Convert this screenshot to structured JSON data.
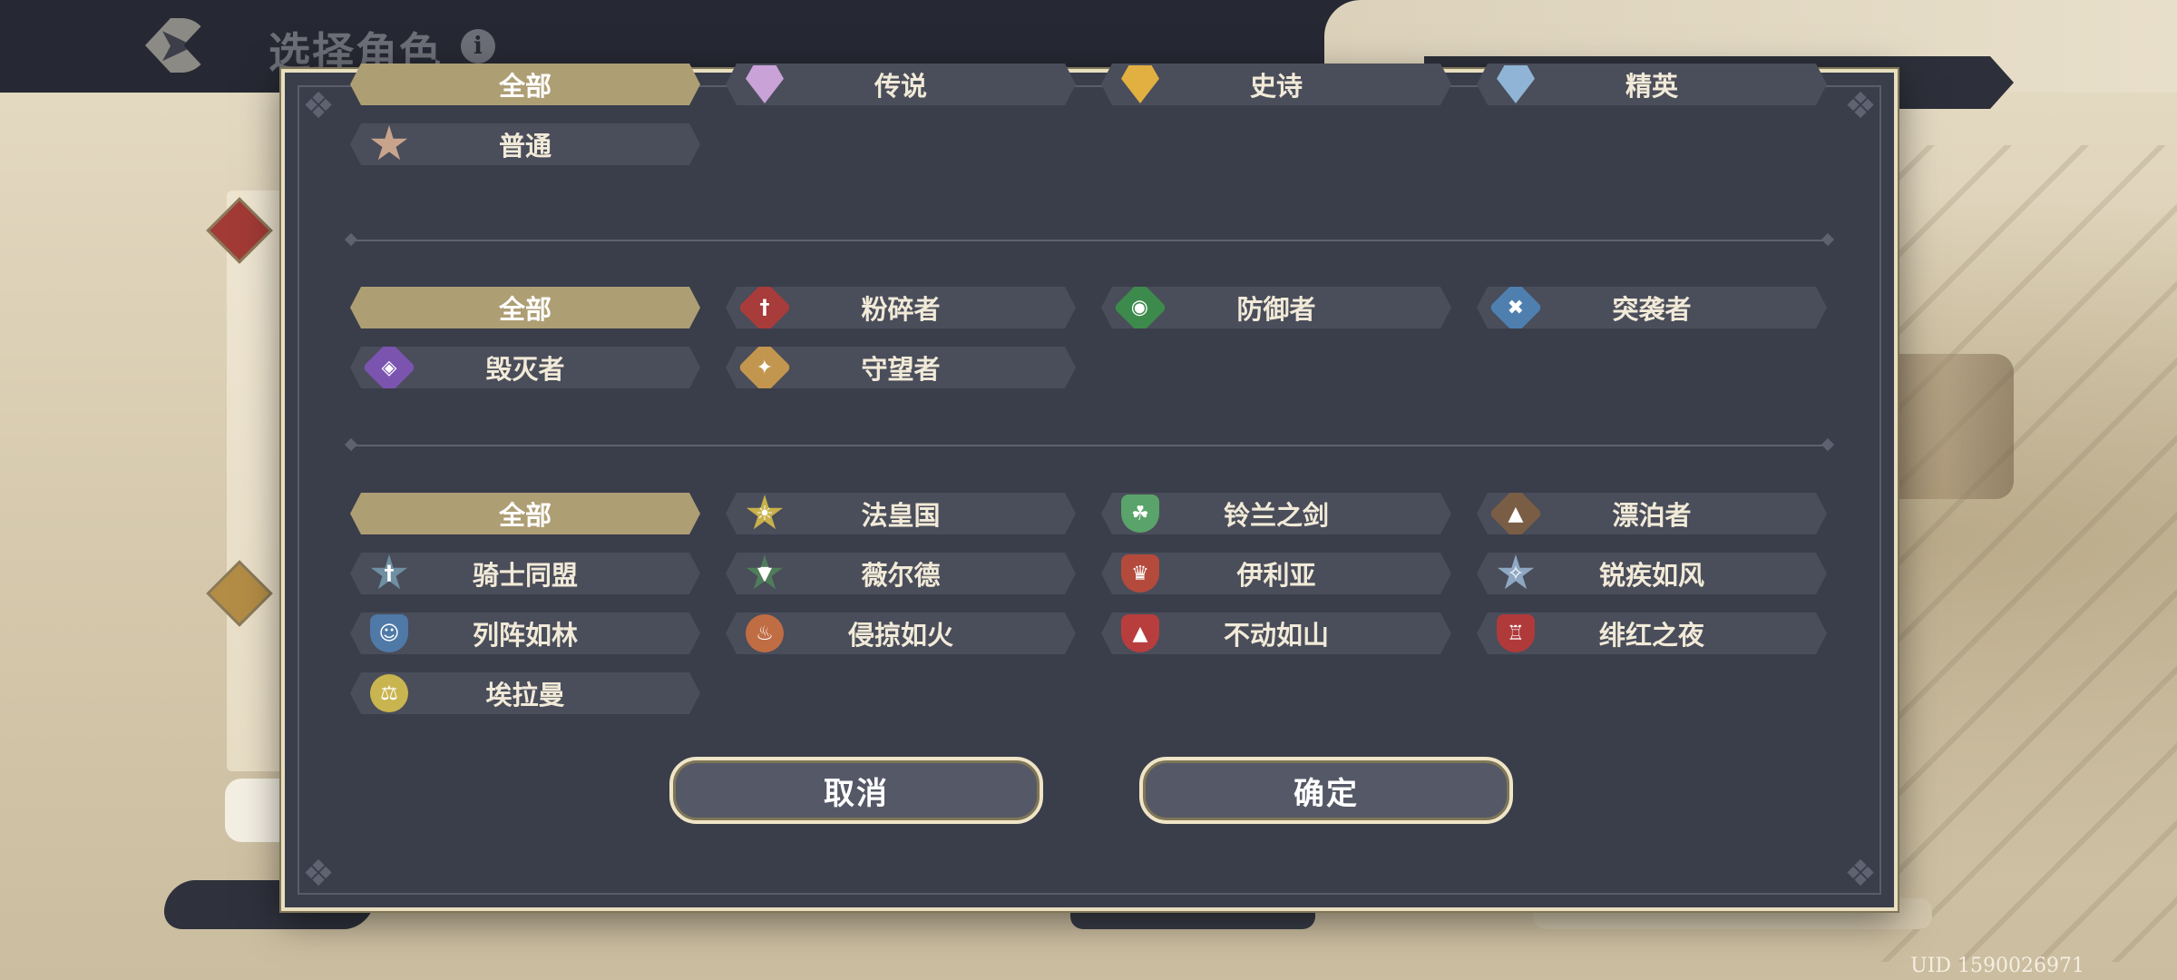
{
  "header": {
    "title": "选择角色",
    "back_icon": "back-arrow-icon",
    "info_icon": "info-icon"
  },
  "footer": {
    "uid": "UID 1590026971"
  },
  "filter_modal": {
    "rarity": [
      {
        "label": "全部",
        "selected": true,
        "icon": ""
      },
      {
        "label": "传说",
        "selected": false,
        "icon": "legendary-gem-icon",
        "color": "#c9a2d8"
      },
      {
        "label": "史诗",
        "selected": false,
        "icon": "epic-gem-icon",
        "color": "#e2b041"
      },
      {
        "label": "精英",
        "selected": false,
        "icon": "elite-gem-icon",
        "color": "#8fb4d6"
      },
      {
        "label": "普通",
        "selected": false,
        "icon": "common-gem-icon",
        "color": "#c9a48c"
      }
    ],
    "class": [
      {
        "label": "全部",
        "selected": true,
        "icon": ""
      },
      {
        "label": "粉碎者",
        "selected": false,
        "icon": "sword-class-icon",
        "color": "#a83c3a"
      },
      {
        "label": "防御者",
        "selected": false,
        "icon": "shield-class-icon",
        "color": "#3c8a4c"
      },
      {
        "label": "突袭者",
        "selected": false,
        "icon": "crossed-blades-class-icon",
        "color": "#4f7fae"
      },
      {
        "label": "毁灭者",
        "selected": false,
        "icon": "arcane-class-icon",
        "color": "#7b54b0"
      },
      {
        "label": "守望者",
        "selected": false,
        "icon": "compass-star-class-icon",
        "color": "#c2964e"
      }
    ],
    "faction": [
      {
        "label": "全部",
        "selected": true,
        "icon": ""
      },
      {
        "label": "法皇国",
        "selected": false,
        "icon": "sun-faction-icon",
        "color": "#c8b14a"
      },
      {
        "label": "铃兰之剑",
        "selected": false,
        "icon": "lily-shield-faction-icon",
        "color": "#5aa36a"
      },
      {
        "label": "漂泊者",
        "selected": false,
        "icon": "wanderer-faction-icon",
        "color": "#7a5d45"
      },
      {
        "label": "骑士同盟",
        "selected": false,
        "icon": "knight-wings-faction-icon",
        "color": "#6f8fa3"
      },
      {
        "label": "薇尔德",
        "selected": false,
        "icon": "wolf-faction-icon",
        "color": "#4f7d5a"
      },
      {
        "label": "伊利亚",
        "selected": false,
        "icon": "crown-faction-icon",
        "color": "#b44a3c"
      },
      {
        "label": "锐疾如风",
        "selected": false,
        "icon": "wind-star-faction-icon",
        "color": "#8ea7c2"
      },
      {
        "label": "列阵如林",
        "selected": false,
        "icon": "soldier-faction-icon",
        "color": "#4f79a7"
      },
      {
        "label": "侵掠如火",
        "selected": false,
        "icon": "fire-faction-icon",
        "color": "#c06d44"
      },
      {
        "label": "不动如山",
        "selected": false,
        "icon": "mountain-shield-faction-icon",
        "color": "#b83e3e"
      },
      {
        "label": "绯红之夜",
        "selected": false,
        "icon": "crimson-tower-faction-icon",
        "color": "#b03a3a"
      },
      {
        "label": "埃拉曼",
        "selected": false,
        "icon": "scales-faction-icon",
        "color": "#c9b54f"
      }
    ],
    "buttons": {
      "cancel": "取消",
      "confirm": "确定"
    }
  },
  "colors": {
    "modal_bg": "#3a3d4a",
    "chip_bg": "#4a4d5a",
    "chip_selected": "#ae9e74",
    "border_gold": "#e9dfbf"
  }
}
